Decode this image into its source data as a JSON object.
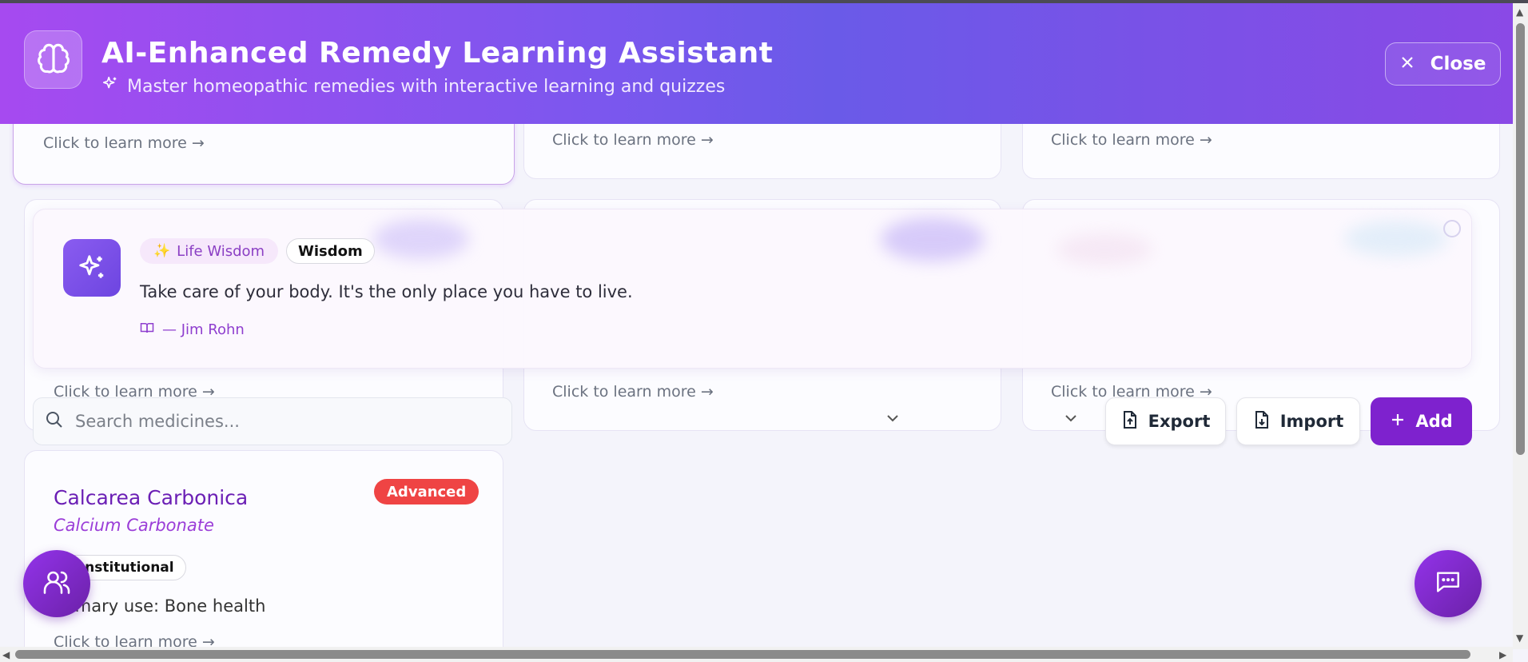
{
  "header": {
    "title": "AI-Enhanced Remedy Learning Assistant",
    "subtitle": "Master homeopathic remedies with interactive learning and quizzes",
    "close_label": "Close"
  },
  "cards": {
    "learn_more": "Click to learn more →"
  },
  "wisdom": {
    "tag_primary": "Life Wisdom",
    "tag_secondary": "Wisdom",
    "quote": "Take care of your body. It's the only place you have to live.",
    "author": "— Jim Rohn"
  },
  "search": {
    "placeholder": "Search medicines..."
  },
  "actions": {
    "export_label": "Export",
    "import_label": "Import",
    "add_label": "Add"
  },
  "medicine": {
    "name": "Calcarea Carbonica",
    "latin": "Calcium Carbonate",
    "level": "Advanced",
    "category": "Constitutional",
    "primary_use": "Primary use: Bone health",
    "learn_more": "Click to learn more →"
  },
  "colors": {
    "accent": "#7e22ce",
    "header_start": "#a64af0",
    "header_end": "#8a49e6",
    "badge_advanced": "#ef4444"
  },
  "icons": {
    "logo": "brain-icon",
    "subtitle": "sparkles-icon",
    "close": "close-icon",
    "wisdom": "sparkles-icon",
    "author": "book-icon",
    "search": "search-icon",
    "export": "file-upload-icon",
    "import": "file-download-icon",
    "add": "plus-icon",
    "users": "users-icon",
    "chat": "chat-icon"
  }
}
